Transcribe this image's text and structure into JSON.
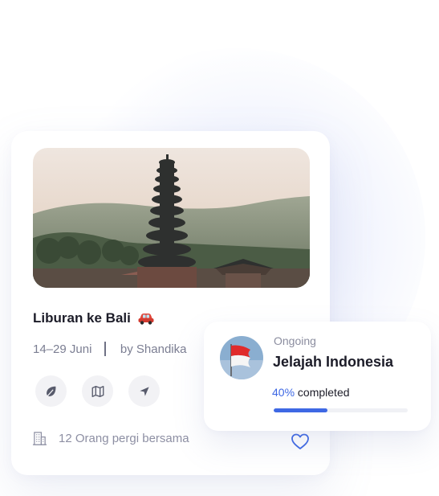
{
  "trip_card": {
    "title": "Liburan ke Bali",
    "dates": "14–29 Juni",
    "author": "by Shandika",
    "people": "12 Orang pergi bersama",
    "actions": [
      "leaf-icon",
      "map-icon",
      "navigation-icon"
    ]
  },
  "ongoing_card": {
    "status": "Ongoing",
    "name": "Jelajah Indonesia",
    "progress_label": "40%",
    "progress_suffix": "completed",
    "progress": 0.4
  },
  "colors": {
    "accent": "#3e68e4",
    "text": "#1c1c28",
    "muted": "#7b7e92",
    "icon_bg": "#f2f2f5"
  }
}
